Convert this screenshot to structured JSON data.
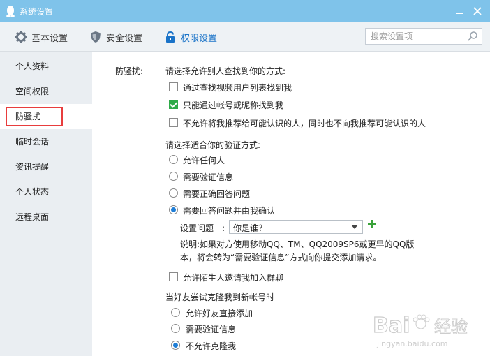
{
  "window": {
    "title": "系统设置"
  },
  "toolbar": {
    "tabs": [
      {
        "label": "基本设置",
        "icon": "gear-icon"
      },
      {
        "label": "安全设置",
        "icon": "shield-icon"
      },
      {
        "label": "权限设置",
        "icon": "lock-icon",
        "active": true
      }
    ],
    "search_placeholder": "搜索设置项"
  },
  "sidebar": {
    "items": [
      {
        "label": "个人资料"
      },
      {
        "label": "空间权限"
      },
      {
        "label": "防骚扰",
        "active": true
      },
      {
        "label": "临时会话"
      },
      {
        "label": "资讯提醒"
      },
      {
        "label": "个人状态"
      },
      {
        "label": "远程桌面"
      }
    ]
  },
  "content": {
    "section_label": "防骚扰:",
    "find": {
      "heading": "请选择允许别人查找到你的方式:",
      "options": [
        {
          "label": "通过查找视频用户列表找到我",
          "checked": false
        },
        {
          "label": "只能通过帐号或昵称找到我",
          "checked": true
        },
        {
          "label": "不允许将我推荐给可能认识的人，同时也不向我推荐可能认识的人",
          "checked": false
        }
      ]
    },
    "verify": {
      "heading": "请选择适合你的验证方式:",
      "options": [
        {
          "label": "允许任何人",
          "checked": false
        },
        {
          "label": "需要验证信息",
          "checked": false
        },
        {
          "label": "需要正确回答问题",
          "checked": false
        },
        {
          "label": "需要回答问题并由我确认",
          "checked": true
        }
      ],
      "question_label": "设置问题一:",
      "question_value": "你是谁？",
      "note_line1": "说明:如果对方使用移动QQ、TM、QQ2009SP6或更早的QQ版",
      "note_line2": "本，将会转为“需要验证信息”方式向你提交添加请求。"
    },
    "group_invite": {
      "label": "允许陌生人邀请我加入群聊",
      "checked": false
    },
    "clone": {
      "heading": "当好友尝试克隆我到新帐号时",
      "options": [
        {
          "label": "允许好友直接添加",
          "checked": false
        },
        {
          "label": "需要验证信息",
          "checked": false
        },
        {
          "label": "不允许克隆我",
          "checked": true
        }
      ]
    }
  },
  "watermark": {
    "text1": "Bai",
    "text2": "经验",
    "url": "jingyan.baidu.com"
  },
  "colors": {
    "titlebar": "#7fc3ea",
    "accent": "#1a73c8",
    "check_green": "#2eaa48",
    "highlight_red": "#e83d3d"
  }
}
